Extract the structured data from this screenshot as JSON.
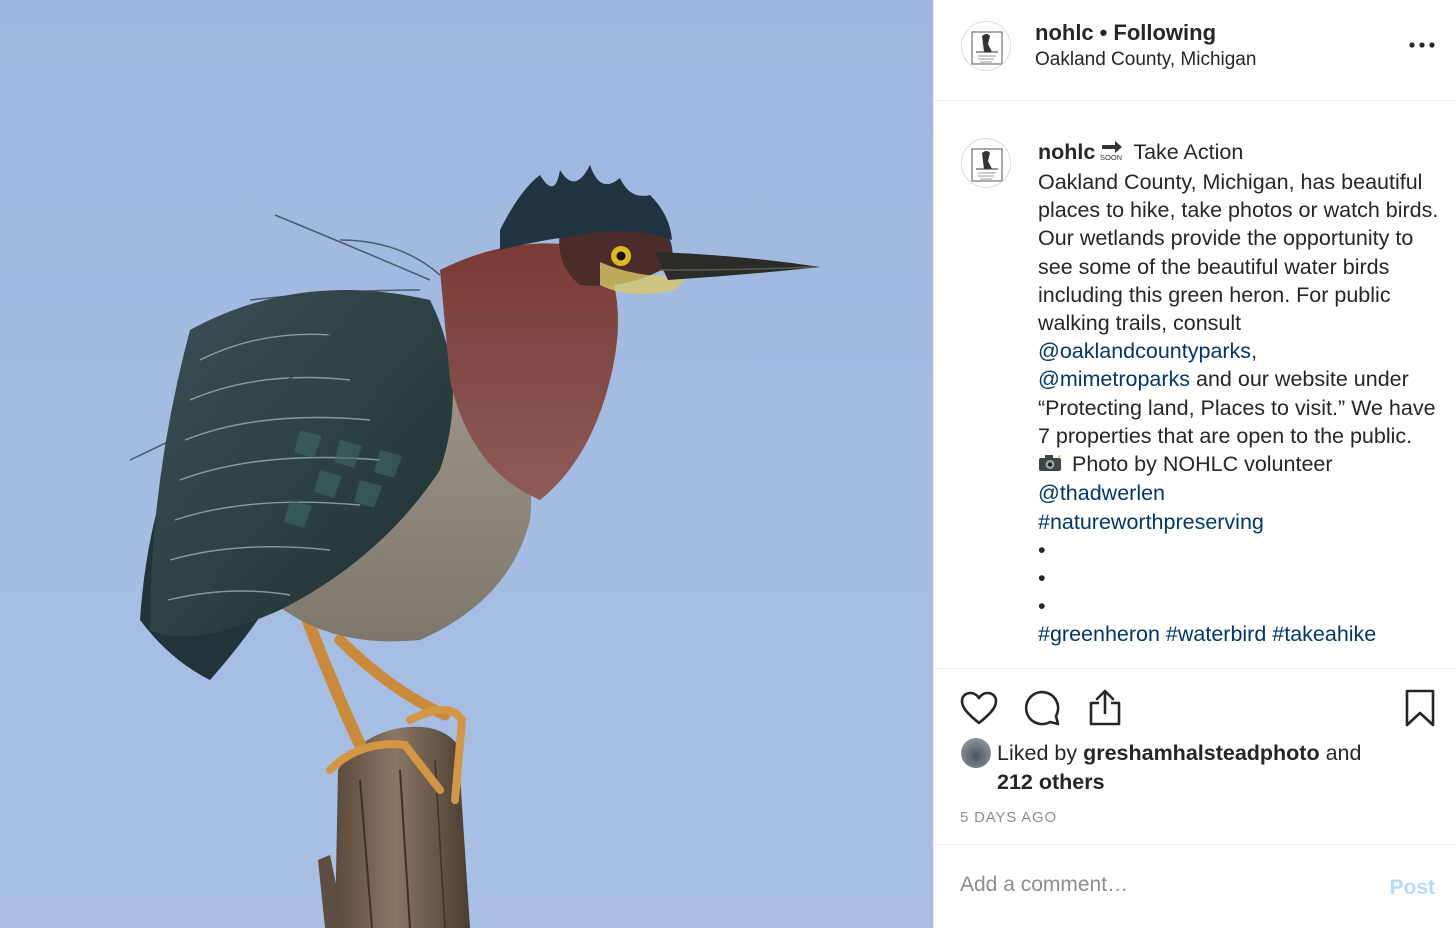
{
  "post": {
    "image_alt": "Green heron perched on a wooden post against a blue sky"
  },
  "header": {
    "username": "nohlc",
    "separator": "•",
    "follow_status": "Following",
    "location": "Oakland County, Michigan",
    "more_icon": "more-horizontal-icon"
  },
  "caption": {
    "username": "nohlc",
    "soon_icon": "soon-arrow-emoji",
    "title": "Take Action",
    "text_1": "Oakland County, Michigan, has beautiful places to hike, take photos or watch birds. Our wetlands provide the opportunity to see some of the beautiful water birds including this green heron. For public walking trails, consult ",
    "mention_1": "@oaklandcountyparks",
    "text_2": ",",
    "mention_2": "@mimetroparks",
    "text_3": " and our website under “Protecting land, Places to visit.” We have 7 properties that are open to the public.",
    "camera_icon": "camera-flash-emoji",
    "photo_credit": "Photo by NOHLC volunteer",
    "mention_3": "@thadwerlen",
    "hashtag_1": "#natureworthpreserving",
    "bullet": "•",
    "hashtags_more": "#greenheron #waterbird #takeahike"
  },
  "actions": {
    "like_icon": "heart-icon",
    "comment_icon": "comment-icon",
    "share_icon": "share-icon",
    "save_icon": "bookmark-icon"
  },
  "likes": {
    "prefix": "Liked by ",
    "user": "greshamhalsteadphoto",
    "middle": " and",
    "count_text": "212 others"
  },
  "timestamp": "5 DAYS AGO",
  "comment": {
    "placeholder": "Add a comment…",
    "post_label": "Post"
  }
}
